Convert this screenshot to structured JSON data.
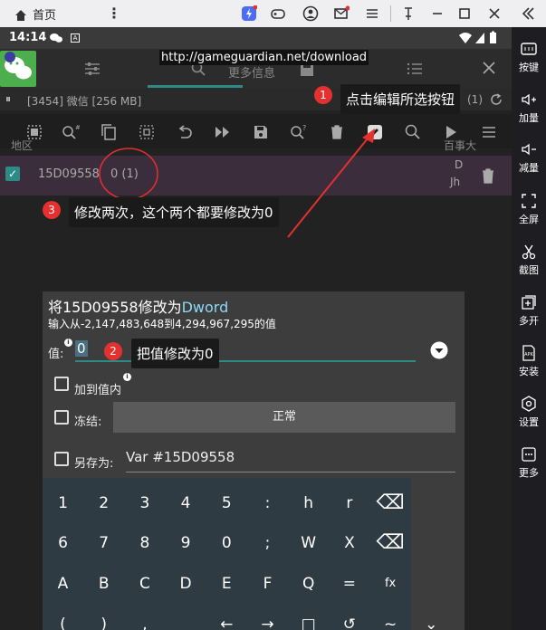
{
  "emulator": {
    "home_label": "首页",
    "side": [
      {
        "label": "按键",
        "icon": "keyboard-icon"
      },
      {
        "label": "加量",
        "icon": "volume-up-icon"
      },
      {
        "label": "减量",
        "icon": "volume-down-icon"
      },
      {
        "label": "全屏",
        "icon": "fullscreen-icon"
      },
      {
        "label": "截图",
        "icon": "scissors-icon"
      },
      {
        "label": "多开",
        "icon": "multi-open-icon"
      },
      {
        "label": "安装",
        "icon": "apk-icon"
      },
      {
        "label": "设置",
        "icon": "settings-icon"
      },
      {
        "label": "更多",
        "icon": "more-icon"
      }
    ]
  },
  "status": {
    "time": "14:14"
  },
  "gg": {
    "header_tab": "更多信息",
    "url_overlay": "http://gameguardian.net/download",
    "process": "[3454] 微信 [256 MB]",
    "process_count": "(1)",
    "col_address": "地区",
    "col_value": "百事大",
    "result": {
      "address": "15D09558",
      "value": "0 (1)",
      "type_top": "D",
      "type_bottom": "Jh"
    }
  },
  "annotations": [
    {
      "num": "1",
      "text": "点击编辑所选按钮"
    },
    {
      "num": "2",
      "text": "把值修改为0"
    },
    {
      "num": "3",
      "text": "修改两次，这个两个都要修改为0"
    }
  ],
  "dialog": {
    "title_prefix": "将15D09558修改为",
    "title_type": "Dword",
    "range": "输入从-2,147,483,648到4,294,967,295的值",
    "value_label": "值:",
    "value": "0",
    "add_label": "加到值内",
    "freeze_label": "冻结:",
    "freeze_mode": "正常",
    "save_label": "另存为:",
    "save_value": "Var #15D09558"
  },
  "keyboard": {
    "rows": [
      [
        "1",
        "2",
        "3",
        "4",
        "5",
        ":",
        "h",
        "r",
        "⌫"
      ],
      [
        "6",
        "7",
        "8",
        "9",
        "0",
        ";",
        "W",
        "X",
        "⌫"
      ],
      [
        "A",
        "B",
        "C",
        "D",
        "E",
        "F",
        "Q",
        "=",
        "fx"
      ],
      [
        "(",
        ")",
        ",",
        "_",
        "←",
        "→",
        "□",
        "↺",
        "~",
        "⌄"
      ]
    ]
  },
  "colors": {
    "accent": "#8ed8f8",
    "badge": "#e53030",
    "highlight_row": "#3b2d3b"
  }
}
